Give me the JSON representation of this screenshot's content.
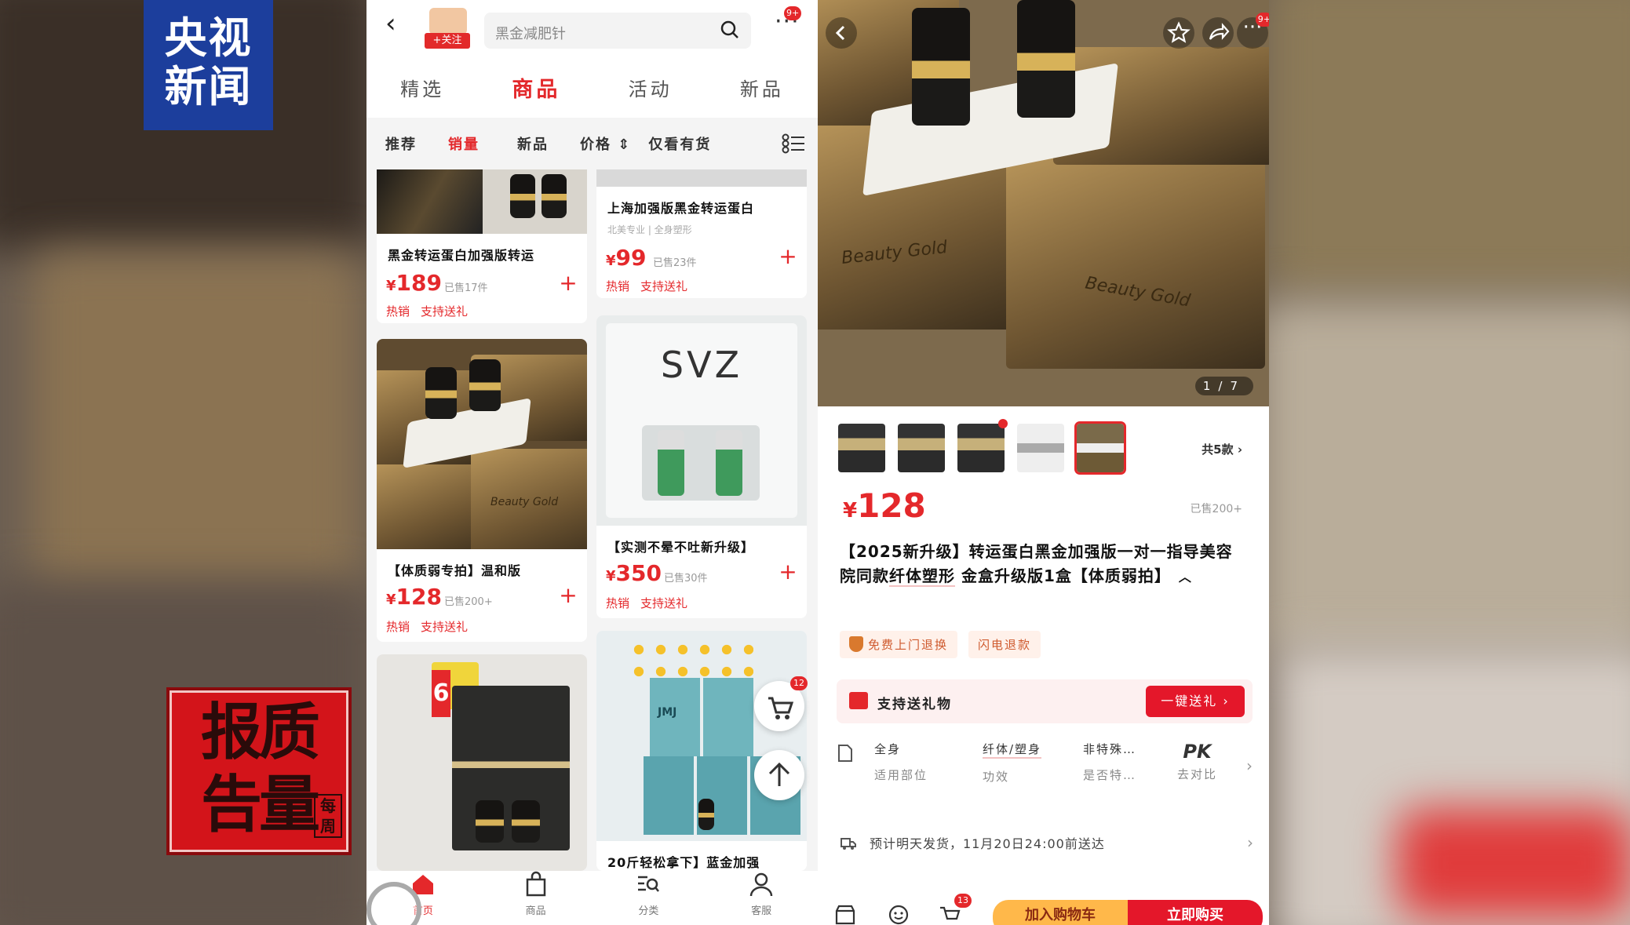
{
  "overlay": {
    "channel_logo": [
      "央视",
      "新闻"
    ],
    "program_logo": [
      "报质",
      "告量"
    ],
    "program_logo_small": "每周"
  },
  "left": {
    "follow": "+关注",
    "search": {
      "placeholder": "黑金减肥针"
    },
    "more_badge": "9+",
    "tabs": [
      "精选",
      "商品",
      "活动",
      "新品"
    ],
    "active_tab": "商品",
    "sort": [
      "推荐",
      "销量",
      "新品",
      "价格 ⇕",
      "仅看有货"
    ],
    "active_sort": "销量",
    "cards": [
      {
        "title": "黑金转运蛋白加强版转运",
        "yen": "¥",
        "price": "189",
        "sold": "已售17件",
        "tags": [
          "热销",
          "支持送礼"
        ]
      },
      {
        "title": "上海加强版黑金转运蛋白",
        "sub": "北美专业 | 全身塑形",
        "yen": "¥",
        "price": "99",
        "sold": "已售23件",
        "tags": [
          "热销",
          "支持送礼"
        ]
      },
      {
        "title": "【体质弱专拍】温和版",
        "yen": "¥",
        "price": "128",
        "sold": "已售200+",
        "tags": [
          "热销",
          "支持送礼"
        ],
        "img_text": "Beauty Gold"
      },
      {
        "title": "【实测不晕不吐新升级】",
        "yen": "¥",
        "price": "350",
        "sold": "已售30件",
        "tags": [
          "热销",
          "支持送礼"
        ],
        "img_text": "SVZ"
      },
      {
        "title": "",
        "img_text": "6"
      },
      {
        "title": "20斤轻松拿下】蓝金加强",
        "img_text": "JMJ"
      }
    ],
    "cart_badge": "12",
    "nav": [
      "首页",
      "商品",
      "分类",
      "客服"
    ],
    "active_nav": "首页"
  },
  "right": {
    "more_badge": "9+",
    "image_counter": "1/7",
    "box_text": "Beauty Gold",
    "thumb_count": "共5款",
    "price_yen": "¥",
    "price": "128",
    "sold": "已售200+",
    "title_parts": [
      "【2025新升级】转运蛋白黑金加强版一对一指导美容院同款",
      "纤体塑形",
      " 金盒升级版1盒【体质弱拍】"
    ],
    "chips": [
      "免费上门退换",
      "闪电退款"
    ],
    "gift_label": "支持送礼物",
    "gift_button": "一键送礼 ›",
    "attrs": [
      {
        "val": "全身",
        "key": "适用部位"
      },
      {
        "val": "纤体/塑身",
        "key": "功效"
      },
      {
        "val": "非特殊…",
        "key": "是否特…"
      },
      {
        "val": "PK",
        "key": "去对比"
      }
    ],
    "shipping": "预计明天发货，11月20日24:00前送达",
    "cart_badge": "13",
    "add_cart": "加入购物车",
    "buy_now": "立即购买"
  },
  "colors": {
    "brand_red": "#e4282b",
    "cctv_blue": "#1c3e9c"
  }
}
